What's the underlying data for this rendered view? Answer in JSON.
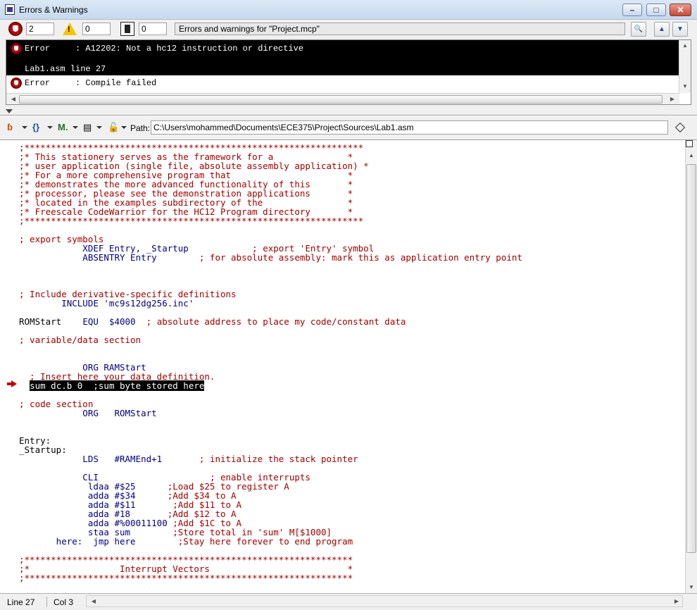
{
  "window": {
    "title": "Errors & Warnings"
  },
  "errors_toolbar": {
    "error_count": "2",
    "warning_count": "0",
    "info_count": "0",
    "message": "Errors and warnings for \"Project.mcp\""
  },
  "errors": [
    {
      "kind": "Error",
      "text": ": A12202: Not a hc12 instruction or directive",
      "location": "Lab1.asm line 27",
      "selected": true
    },
    {
      "kind": "Error",
      "text": ": Compile failed",
      "location": "",
      "selected": false
    }
  ],
  "editor_toolbar": {
    "path_label": "Path:",
    "path": "C:\\Users\\mohammed\\Documents\\ECE375\\Project\\Sources\\Lab1.asm",
    "icons": [
      "function-menu-icon",
      "braces-menu-icon",
      "markers-menu-icon",
      "document-menu-icon",
      "lock-menu-icon"
    ]
  },
  "code_lines": [
    {
      "t": ";****************************************************************",
      "c": "red"
    },
    {
      "t": ";* This stationery serves as the framework for a              *",
      "c": "red"
    },
    {
      "t": ";* user application (single file, absolute assembly application) *",
      "c": "red"
    },
    {
      "t": ";* For a more comprehensive program that                      *",
      "c": "red"
    },
    {
      "t": ";* demonstrates the more advanced functionality of this       *",
      "c": "red"
    },
    {
      "t": ";* processor, please see the demonstration applications       *",
      "c": "red"
    },
    {
      "t": ";* located in the examples subdirectory of the                *",
      "c": "red"
    },
    {
      "t": ";* Freescale CodeWarrior for the HC12 Program directory       *",
      "c": "red"
    },
    {
      "t": ";****************************************************************",
      "c": "red"
    },
    {
      "t": "",
      "c": "blk"
    },
    {
      "t": "; export symbols",
      "c": "red"
    },
    {
      "t": "            XDEF Entry, _Startup            ; export 'Entry' symbol",
      "c": "mix1"
    },
    {
      "t": "            ABSENTRY Entry        ; for absolute assembly: mark this as application entry point",
      "c": "mix2"
    },
    {
      "t": "",
      "c": "blk"
    },
    {
      "t": "",
      "c": "blk"
    },
    {
      "t": "",
      "c": "blk"
    },
    {
      "t": "; Include derivative-specific definitions",
      "c": "red"
    },
    {
      "t": "        INCLUDE 'mc9s12dg256.inc'",
      "c": "navy"
    },
    {
      "t": "",
      "c": "blk"
    },
    {
      "t": "ROMStart    EQU  $4000  ; absolute address to place my code/constant data",
      "c": "mix3"
    },
    {
      "t": "",
      "c": "blk"
    },
    {
      "t": "; variable/data section",
      "c": "red"
    },
    {
      "t": "",
      "c": "blk"
    },
    {
      "t": "",
      "c": "blk"
    },
    {
      "t": "            ORG RAMStart",
      "c": "navy"
    },
    {
      "t": "  ; Insert here your data definition.",
      "c": "red"
    },
    {
      "t": "  sum dc.b 0  ;sum byte stored here",
      "c": "hl"
    },
    {
      "t": "",
      "c": "blk"
    },
    {
      "t": "; code section",
      "c": "red"
    },
    {
      "t": "            ORG   ROMStart",
      "c": "navy"
    },
    {
      "t": "",
      "c": "blk"
    },
    {
      "t": "",
      "c": "blk"
    },
    {
      "t": "Entry:",
      "c": "blk"
    },
    {
      "t": "_Startup:",
      "c": "blk"
    },
    {
      "t": "            LDS   #RAMEnd+1       ; initialize the stack pointer",
      "c": "mix4"
    },
    {
      "t": "",
      "c": "blk"
    },
    {
      "t": "            CLI                     ; enable interrupts",
      "c": "mix5"
    },
    {
      "t": "             ldaa #$25      ;Load $25 to register A",
      "c": "mix6"
    },
    {
      "t": "             adda #$34      ;Add $34 to A",
      "c": "mix6"
    },
    {
      "t": "             adda #$11       ;Add $11 to A",
      "c": "mix7"
    },
    {
      "t": "             adda #18       ;Add $12 to A",
      "c": "mix6"
    },
    {
      "t": "             adda #%00011100 ;Add $1C to A",
      "c": "mix8"
    },
    {
      "t": "             staa sum        ;Store total in 'sum' M[$1000]",
      "c": "mix7"
    },
    {
      "t": "       here:  jmp here        ;Stay here forever to end program",
      "c": "mix7"
    },
    {
      "t": "",
      "c": "blk"
    },
    {
      "t": ";**************************************************************",
      "c": "red"
    },
    {
      "t": ";*                 Interrupt Vectors                          *",
      "c": "red"
    },
    {
      "t": ";**************************************************************",
      "c": "red"
    }
  ],
  "status": {
    "line": "Line 27",
    "col": "Col 3"
  }
}
